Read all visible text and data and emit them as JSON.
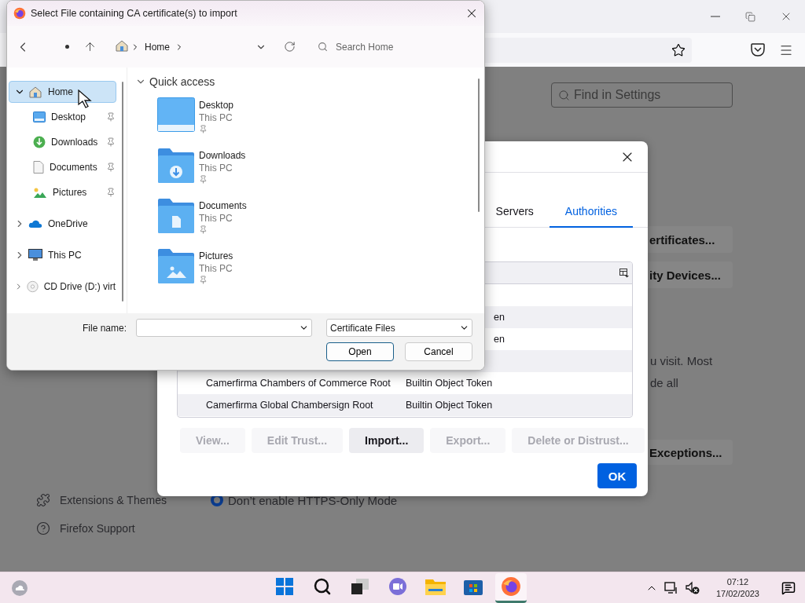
{
  "browser": {
    "settings": {
      "search": {
        "placeholder": "Find in Settings"
      },
      "buttons": [
        {
          "label": "ertificates..."
        },
        {
          "label": "ity Devices..."
        }
      ],
      "text_lines": [
        "u visit. Most",
        "de all"
      ],
      "exceptions_button": {
        "label": "Exceptions..."
      },
      "nav": [
        {
          "label": "Extensions & Themes",
          "kind": "extensions"
        },
        {
          "label": "Firefox Support",
          "kind": "support"
        }
      ],
      "https_option": {
        "label": "Don’t enable HTTPS-Only Mode",
        "selected": true
      }
    }
  },
  "certificate_manager": {
    "tabs": [
      {
        "label": "Servers",
        "selected": false
      },
      {
        "label": "Authorities",
        "selected": true
      }
    ],
    "rows": [
      {
        "kind": "empty"
      },
      {
        "kind": "clipped",
        "token": "en"
      },
      {
        "kind": "clipped",
        "token": "en"
      },
      {
        "kind": "empty"
      },
      {
        "kind": "full",
        "name": "Camerfirma Chambers of Commerce Root",
        "token": "Builtin Object Token"
      },
      {
        "kind": "full",
        "name": "Camerfirma Global Chambersign Root",
        "token": "Builtin Object Token"
      }
    ],
    "buttons": [
      {
        "label": "View...",
        "disabled": true
      },
      {
        "label": "Edit Trust...",
        "disabled": true
      },
      {
        "label": "Import...",
        "disabled": false
      },
      {
        "label": "Export...",
        "disabled": true
      },
      {
        "label": "Delete or Distrust...",
        "disabled": true
      }
    ],
    "ok_button": "OK"
  },
  "file_dialog": {
    "title": "Select File containing CA certificate(s) to import",
    "breadcrumb": [
      "Home"
    ],
    "search": {
      "placeholder": "Search Home"
    },
    "sidebar": [
      {
        "label": "Home",
        "kind": "home",
        "selected": true,
        "expanded": true,
        "children": [
          {
            "label": "Desktop",
            "kind": "desktop",
            "selected": false,
            "pinned": true
          },
          {
            "label": "Downloads",
            "kind": "downloads",
            "selected": false,
            "pinned": true
          },
          {
            "label": "Documents",
            "kind": "documents",
            "selected": false,
            "pinned": true
          },
          {
            "label": "Pictures",
            "kind": "pictures",
            "selected": false,
            "pinned": true
          }
        ]
      },
      {
        "label": "OneDrive",
        "kind": "onedrive",
        "selected": false,
        "expanded": false
      },
      {
        "label": "This PC",
        "kind": "pc",
        "selected": false,
        "expanded": false
      },
      {
        "label": "CD Drive (D:) virt",
        "kind": "cd",
        "selected": false,
        "expanded": false
      }
    ],
    "quick_access": {
      "title": "Quick access",
      "expanded": true,
      "items": [
        {
          "name": "Desktop",
          "location": "This PC",
          "kind": "desktop",
          "pinned": true
        },
        {
          "name": "Downloads",
          "location": "This PC",
          "kind": "downloads",
          "pinned": true
        },
        {
          "name": "Documents",
          "location": "This PC",
          "kind": "documents",
          "pinned": true
        },
        {
          "name": "Pictures",
          "location": "This PC",
          "kind": "pictures",
          "pinned": true
        }
      ]
    },
    "file_name_label": "File name:",
    "file_type": "Certificate Files",
    "buttons": [
      {
        "label": "Open",
        "default": true
      },
      {
        "label": "Cancel",
        "default": false
      }
    ]
  },
  "taskbar": {
    "apps": [
      {
        "kind": "start",
        "active": false
      },
      {
        "kind": "search",
        "active": false
      },
      {
        "kind": "taskview",
        "active": false
      },
      {
        "kind": "chat",
        "active": false
      },
      {
        "kind": "explorer",
        "active": false
      },
      {
        "kind": "store",
        "active": false
      },
      {
        "kind": "firefox",
        "active": true
      }
    ],
    "clock": {
      "time": "07:12",
      "date": "17/02/2023"
    }
  }
}
